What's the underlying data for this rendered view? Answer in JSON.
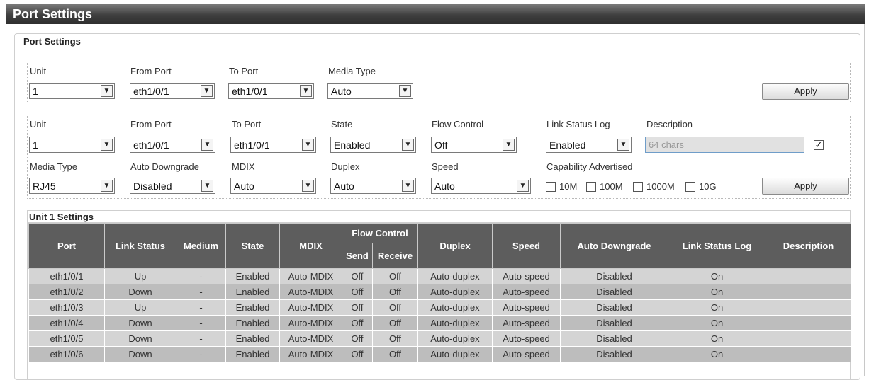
{
  "window_title": "Port Settings",
  "section_legend": "Port Settings",
  "form1": {
    "unit_label": "Unit",
    "unit_value": "1",
    "from_port_label": "From Port",
    "from_port_value": "eth1/0/1",
    "to_port_label": "To Port",
    "to_port_value": "eth1/0/1",
    "media_type_label": "Media Type",
    "media_type_value": "Auto",
    "apply_label": "Apply"
  },
  "form2": {
    "unit_label": "Unit",
    "unit_value": "1",
    "from_port_label": "From Port",
    "from_port_value": "eth1/0/1",
    "to_port_label": "To Port",
    "to_port_value": "eth1/0/1",
    "state_label": "State",
    "state_value": "Enabled",
    "flow_control_label": "Flow Control",
    "flow_control_value": "Off",
    "link_status_log_label": "Link Status Log",
    "link_status_log_value": "Enabled",
    "description_label": "Description",
    "description_placeholder": "64 chars",
    "description_checked": true,
    "media_type_label": "Media Type",
    "media_type_value": "RJ45",
    "auto_downgrade_label": "Auto Downgrade",
    "auto_downgrade_value": "Disabled",
    "mdix_label": "MDIX",
    "mdix_value": "Auto",
    "duplex_label": "Duplex",
    "duplex_value": "Auto",
    "speed_label": "Speed",
    "speed_value": "Auto",
    "capability_label": "Capability Advertised",
    "capabilities": [
      "10M",
      "100M",
      "1000M",
      "10G"
    ],
    "apply_label": "Apply"
  },
  "unit_settings_title": "Unit 1 Settings",
  "table": {
    "headers": {
      "port": "Port",
      "link_status": "Link Status",
      "medium": "Medium",
      "state": "State",
      "mdix": "MDIX",
      "flow_control": "Flow Control",
      "send": "Send",
      "receive": "Receive",
      "duplex": "Duplex",
      "speed": "Speed",
      "auto_downgrade": "Auto Downgrade",
      "link_status_log": "Link Status Log",
      "description": "Description"
    },
    "rows": [
      {
        "port": "eth1/0/1",
        "link_status": "Up",
        "medium": "-",
        "state": "Enabled",
        "mdix": "Auto-MDIX",
        "send": "Off",
        "receive": "Off",
        "duplex": "Auto-duplex",
        "speed": "Auto-speed",
        "auto_downgrade": "Disabled",
        "link_status_log": "On",
        "description": ""
      },
      {
        "port": "eth1/0/2",
        "link_status": "Down",
        "medium": "-",
        "state": "Enabled",
        "mdix": "Auto-MDIX",
        "send": "Off",
        "receive": "Off",
        "duplex": "Auto-duplex",
        "speed": "Auto-speed",
        "auto_downgrade": "Disabled",
        "link_status_log": "On",
        "description": ""
      },
      {
        "port": "eth1/0/3",
        "link_status": "Up",
        "medium": "-",
        "state": "Enabled",
        "mdix": "Auto-MDIX",
        "send": "Off",
        "receive": "Off",
        "duplex": "Auto-duplex",
        "speed": "Auto-speed",
        "auto_downgrade": "Disabled",
        "link_status_log": "On",
        "description": ""
      },
      {
        "port": "eth1/0/4",
        "link_status": "Down",
        "medium": "-",
        "state": "Enabled",
        "mdix": "Auto-MDIX",
        "send": "Off",
        "receive": "Off",
        "duplex": "Auto-duplex",
        "speed": "Auto-speed",
        "auto_downgrade": "Disabled",
        "link_status_log": "On",
        "description": ""
      },
      {
        "port": "eth1/0/5",
        "link_status": "Down",
        "medium": "-",
        "state": "Enabled",
        "mdix": "Auto-MDIX",
        "send": "Off",
        "receive": "Off",
        "duplex": "Auto-duplex",
        "speed": "Auto-speed",
        "auto_downgrade": "Disabled",
        "link_status_log": "On",
        "description": ""
      },
      {
        "port": "eth1/0/6",
        "link_status": "Down",
        "medium": "-",
        "state": "Enabled",
        "mdix": "Auto-MDIX",
        "send": "Off",
        "receive": "Off",
        "duplex": "Auto-duplex",
        "speed": "Auto-speed",
        "auto_downgrade": "Disabled",
        "link_status_log": "On",
        "description": ""
      }
    ]
  }
}
